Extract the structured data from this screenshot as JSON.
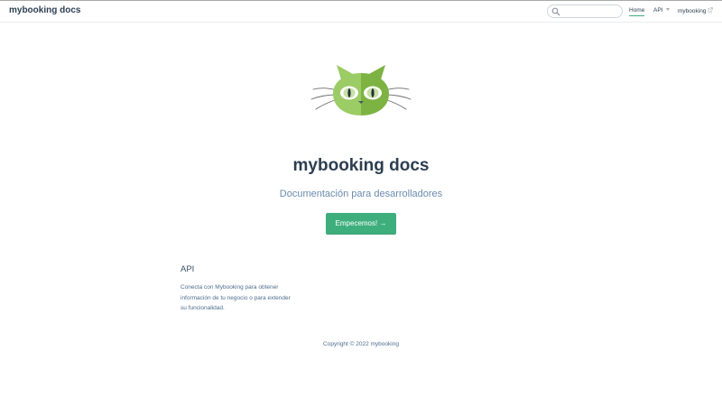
{
  "site": {
    "name": "mybooking docs"
  },
  "search": {
    "value": "",
    "placeholder": ""
  },
  "nav": {
    "items": [
      {
        "label": "Home",
        "active": true
      },
      {
        "label": "API",
        "has_dropdown": true
      },
      {
        "label": "mybooking",
        "external": true
      }
    ]
  },
  "hero": {
    "title": "mybooking docs",
    "description": "Documentación para desarrolladores",
    "action_label": "Empecemos! →",
    "logo_icon": "cat-logo-icon"
  },
  "features": [
    {
      "title": "API",
      "details": "Conecta con Mybooking para obtener información de tu negocio o para extender su funcionalidad."
    }
  ],
  "footer": {
    "text": "Copyright © 2022 mybooking"
  },
  "colors": {
    "accent": "#3eaf7c",
    "text": "#2c3e50",
    "muted": "#6a8bad",
    "logo_light": "#9ccc65",
    "logo_dark": "#7cb342"
  }
}
